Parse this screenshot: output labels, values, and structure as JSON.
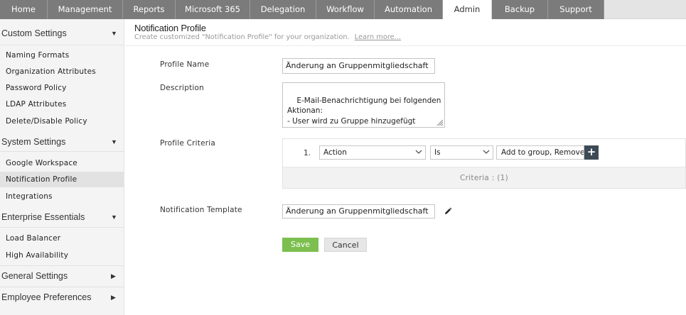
{
  "topnav": {
    "tabs": [
      {
        "label": "Home",
        "width": 67
      },
      {
        "label": "Management",
        "width": 106
      },
      {
        "label": "Reports",
        "width": 74
      },
      {
        "label": "Microsoft 365",
        "width": 105
      },
      {
        "label": "Delegation",
        "width": 93
      },
      {
        "label": "Workflow",
        "width": 82
      },
      {
        "label": "Automation",
        "width": 96
      },
      {
        "label": "Admin",
        "width": 69
      },
      {
        "label": "Backup",
        "width": 79
      },
      {
        "label": "Support",
        "width": 79
      }
    ],
    "active": "Admin"
  },
  "sidebar": {
    "custom_settings": "Custom Settings",
    "naming_formats": "Naming Formats",
    "organization_attributes": "Organization Attributes",
    "password_policy": "Password Policy",
    "ldap_attributes": "LDAP Attributes",
    "delete_disable_policy": "Delete/Disable Policy",
    "system_settings": "System Settings",
    "google_workspace": "Google Workspace",
    "notification_profile": "Notification Profile",
    "integrations": "Integrations",
    "enterprise_essentials": "Enterprise Essentials",
    "load_balancer": "Load Balancer",
    "high_availability": "High Availability",
    "general_settings": "General Settings",
    "employee_preferences": "Employee Preferences"
  },
  "page": {
    "title": "Notification Profile",
    "subtitle": "Create customized \"Notification Profile\" for your organization.",
    "learn_more": "Learn more..."
  },
  "form": {
    "profile_name_label": "Profile Name",
    "profile_name_value": "Änderung an Gruppenmitgliedschaft",
    "description_label": "Description",
    "description_value": "E-Mail-Benachrichtigung bei folgenden\nAktionan:\n- User wird zu Gruppe hinzugefügt\n- User wird aus Gruppe gelöscht ...",
    "profile_criteria_label": "Profile Criteria",
    "criteria_row_num": "1.",
    "criteria_field": "Action",
    "criteria_operator": "Is",
    "criteria_value": "Add to group, Remove from group",
    "criteria_count": "Criteria : (1)",
    "notification_template_label": "Notification Template",
    "notification_template_value": "Änderung an Gruppenmitgliedschaft",
    "save_label": "Save",
    "cancel_label": "Cancel"
  },
  "colors": {
    "tab_bg": "#7b7b7b",
    "save_green": "#7cbf4f",
    "plus_dark": "#3d4a55"
  }
}
